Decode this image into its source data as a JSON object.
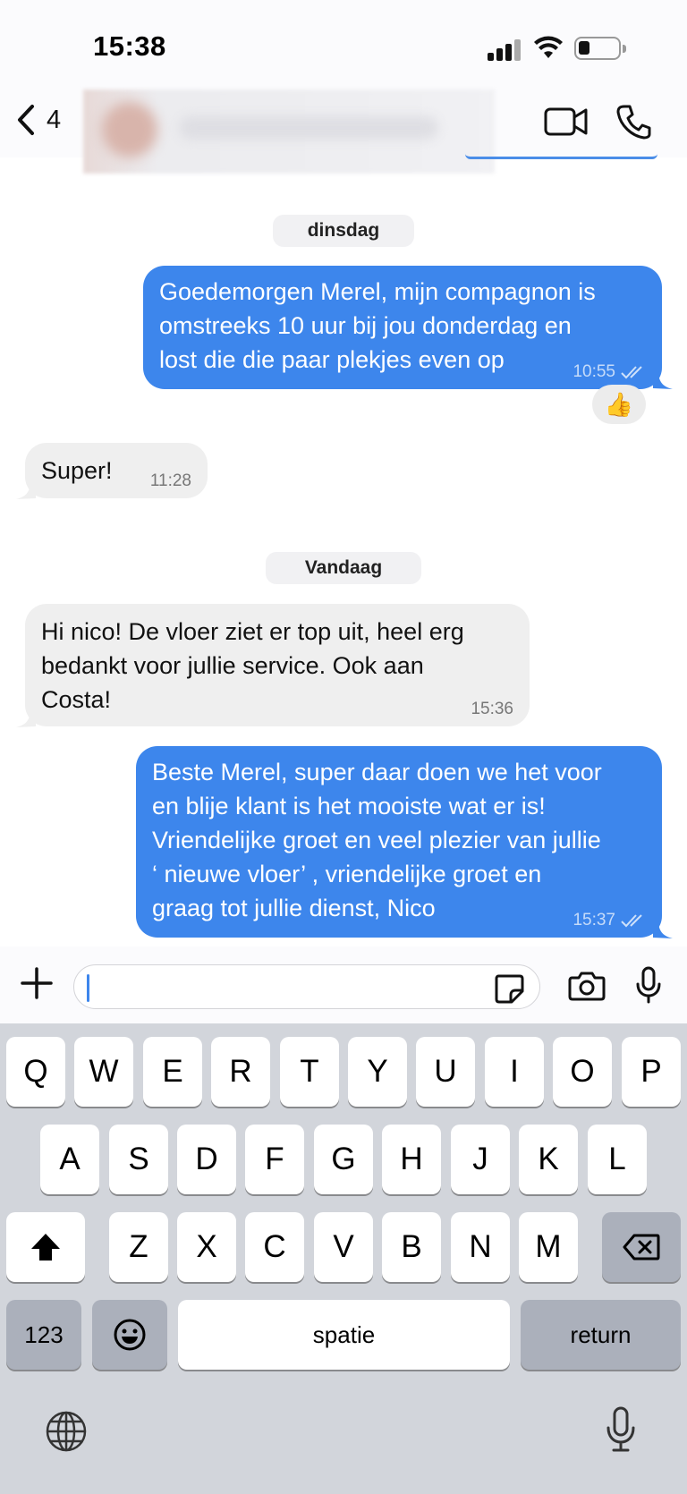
{
  "status_bar": {
    "time": "15:38"
  },
  "nav": {
    "back_count": "4"
  },
  "chat": {
    "day_1": "dinsdag",
    "msg_1": {
      "lines": [
        "Goedemorgen Merel, mijn compagnon is",
        "omstreeks 10 uur bij jou donderdag en",
        "lost die die paar plekjes even op"
      ],
      "time": "10:55",
      "reaction": "👍"
    },
    "msg_2": {
      "text": "Super!",
      "time": "11:28"
    },
    "day_2": "Vandaag",
    "msg_3": {
      "lines": [
        "Hi nico! De vloer ziet er top uit, heel erg",
        "bedankt voor jullie service. Ook aan",
        "Costa!"
      ],
      "time": "15:36"
    },
    "msg_4": {
      "lines": [
        "Beste Merel, super daar doen we het voor",
        "en blije klant is het mooiste wat er is!",
        "Vriendelijke groet en veel plezier van jullie",
        "‘ nieuwe vloer’ , vriendelijke groet en",
        "graag tot jullie dienst, Nico"
      ],
      "time": "15:37"
    }
  },
  "input": {
    "placeholder": ""
  },
  "keyboard": {
    "row_1": [
      "Q",
      "W",
      "E",
      "R",
      "T",
      "Y",
      "U",
      "I",
      "O",
      "P"
    ],
    "row_2": [
      "A",
      "S",
      "D",
      "F",
      "G",
      "H",
      "J",
      "K",
      "L"
    ],
    "row_3": [
      "Z",
      "X",
      "C",
      "V",
      "B",
      "N",
      "M"
    ],
    "numbers_key": "123",
    "space_key": "spatie",
    "return_key": "return"
  },
  "colors": {
    "outgoing_bubble": "#3d86ec",
    "incoming_bubble": "#efefef",
    "keyboard_bg": "#d2d5db"
  },
  "icons": [
    "back-chevron-icon",
    "video-call-icon",
    "phone-icon",
    "plus-icon",
    "sticker-icon",
    "camera-icon",
    "microphone-icon",
    "shift-icon",
    "backspace-icon",
    "emoji-icon",
    "globe-icon",
    "dictation-icon",
    "double-check-icon"
  ]
}
